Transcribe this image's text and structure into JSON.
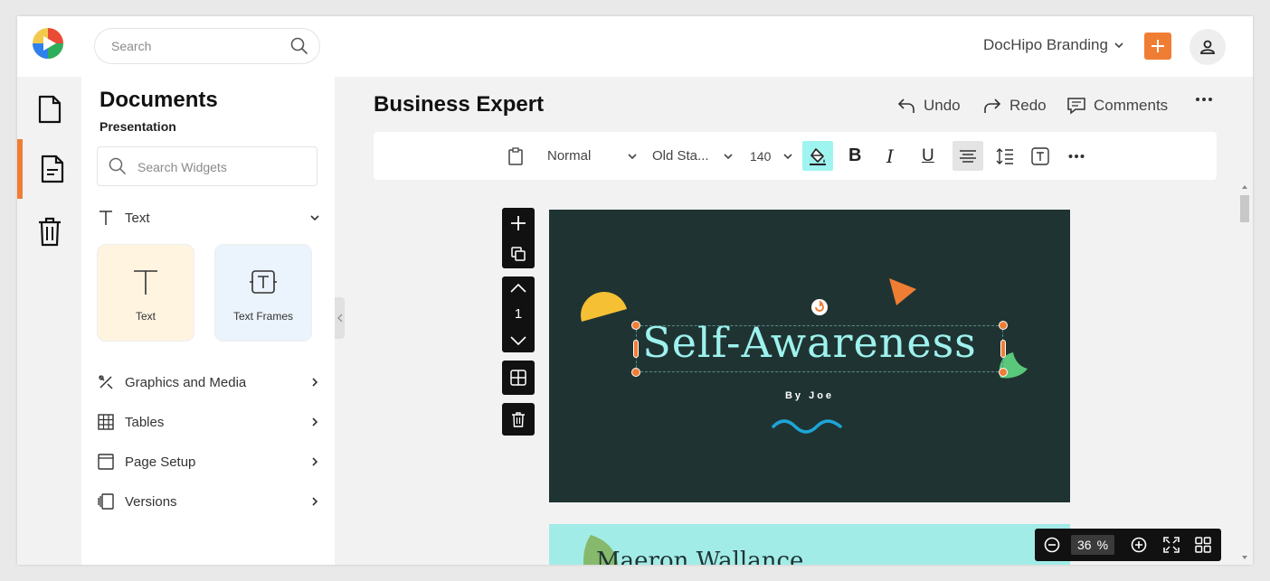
{
  "header": {
    "search_placeholder": "Search",
    "brand_label": "DocHipo Branding",
    "accent_color": "#f07d34"
  },
  "rail": {
    "items": [
      "document-icon",
      "widgets-icon",
      "trash-icon"
    ],
    "active_index": 1
  },
  "panel": {
    "title": "Documents",
    "subtitle": "Presentation",
    "widget_search_placeholder": "Search Widgets",
    "text_section": "Text",
    "cards": [
      {
        "label": "Text",
        "icon": "text-t-icon"
      },
      {
        "label": "Text Frames",
        "icon": "text-frame-icon"
      }
    ],
    "sections": [
      {
        "label": "Graphics and Media",
        "icon": "graphics-icon"
      },
      {
        "label": "Tables",
        "icon": "table-icon"
      },
      {
        "label": "Page Setup",
        "icon": "page-setup-icon"
      },
      {
        "label": "Versions",
        "icon": "versions-icon"
      }
    ]
  },
  "main": {
    "doc_title": "Business Expert",
    "actions": {
      "undo": "Undo",
      "redo": "Redo",
      "comments": "Comments"
    },
    "toolbar": {
      "style": "Normal",
      "font": "Old Sta...",
      "size": "140",
      "fill_color": "#9ff4f0"
    },
    "page_number": "1",
    "slide1": {
      "title": "Self-Awareness",
      "byline": "By Joe",
      "background": "#1f3432",
      "title_color": "#9ef2ee"
    },
    "slide2": {
      "title": "Maeron Wallance",
      "background": "#a2ece8"
    },
    "zoom": {
      "value": "36",
      "unit": "%"
    }
  }
}
